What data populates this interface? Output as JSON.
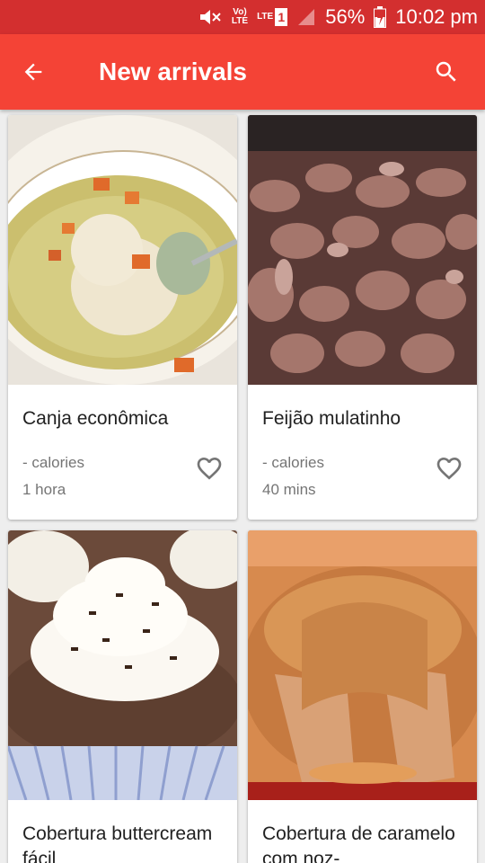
{
  "status": {
    "battery": "56%",
    "time": "10:02 pm",
    "network": "LTE",
    "sim": "1",
    "volte": "Vo) LTE"
  },
  "appbar": {
    "title": "New arrivals",
    "back_icon": "arrow-back-icon",
    "search_icon": "search-icon",
    "color": "#f44336",
    "status_color": "#d32f2f"
  },
  "recipes": [
    {
      "title": "Canja econômica",
      "calories": "- calories",
      "time": "1 hora"
    },
    {
      "title": "Feijão mulatinho",
      "calories": "- calories",
      "time": "40 mins"
    },
    {
      "title": "Cobertura buttercream fácil",
      "calories": "",
      "time": ""
    },
    {
      "title": "Cobertura de caramelo com noz-",
      "calories": "",
      "time": ""
    }
  ]
}
